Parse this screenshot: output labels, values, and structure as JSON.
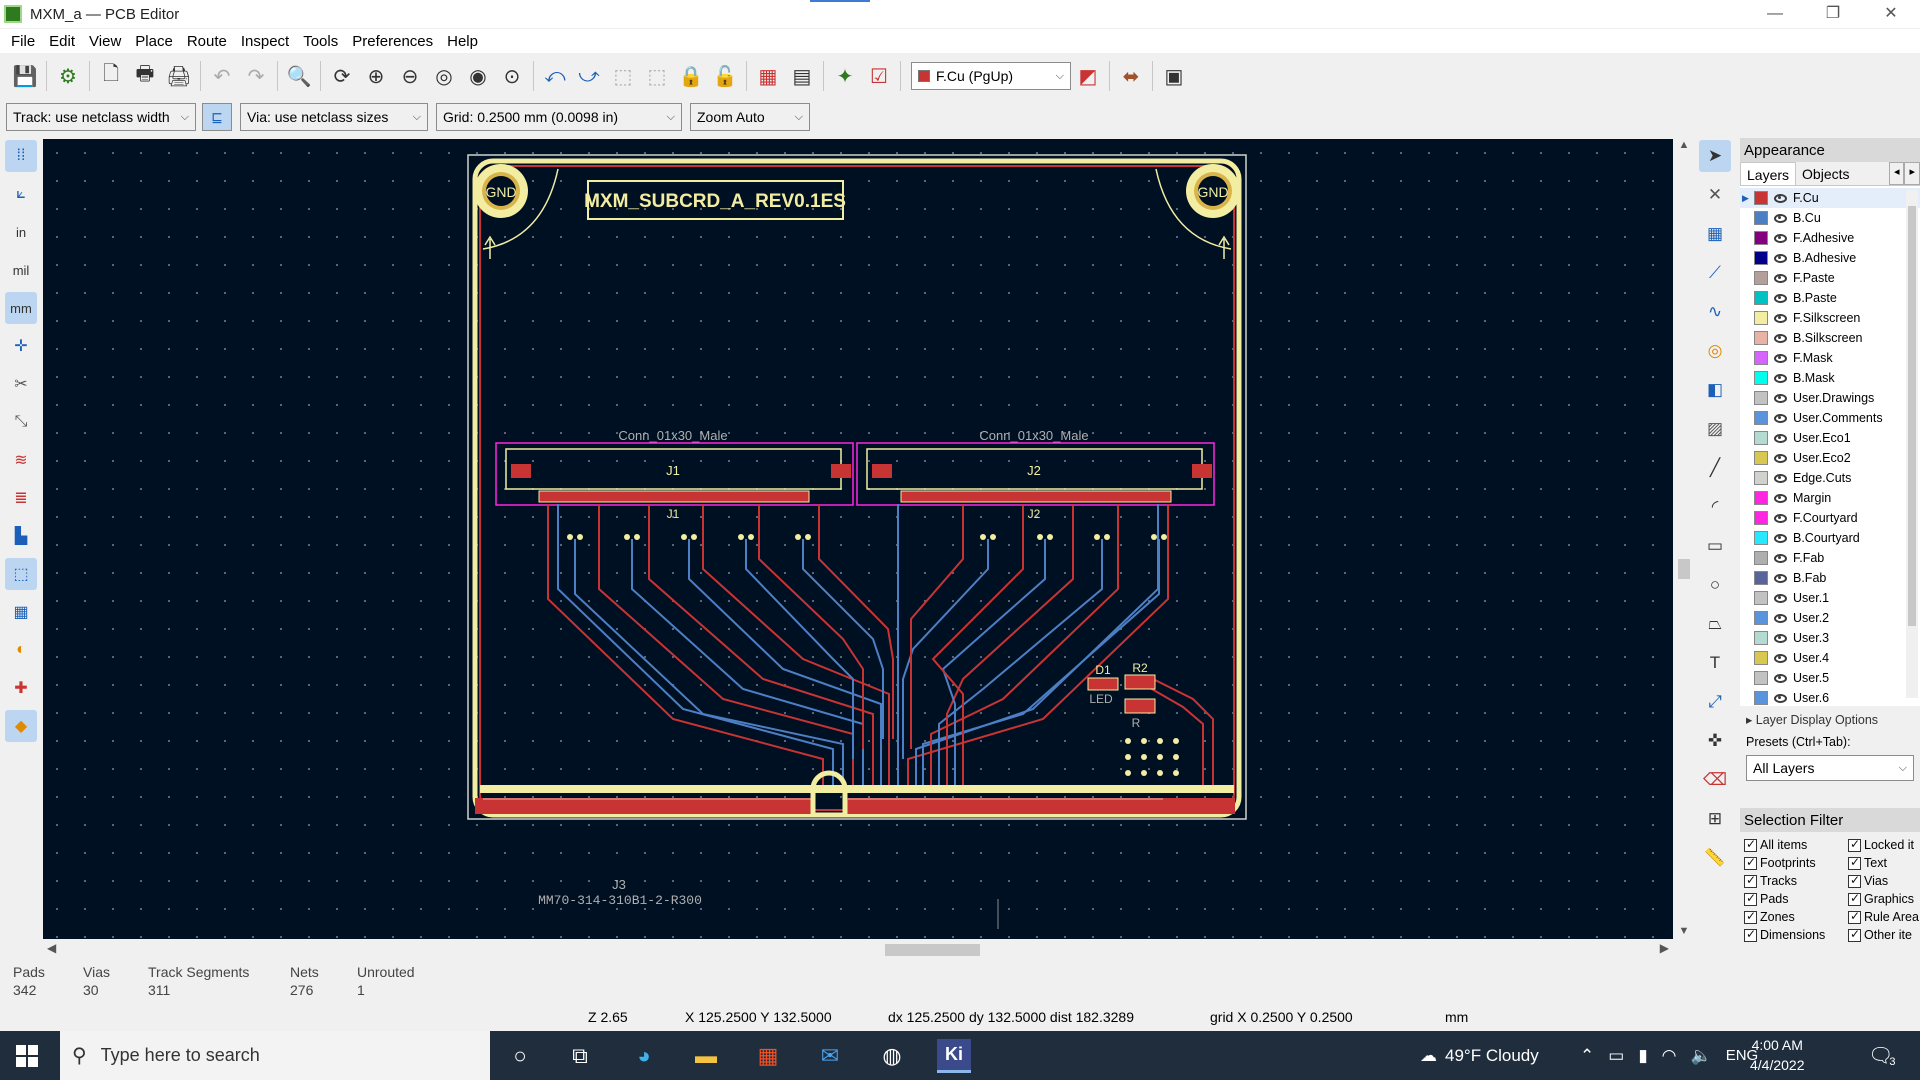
{
  "window": {
    "title": "MXM_a — PCB Editor",
    "controls": [
      "—",
      "❐",
      "✕"
    ]
  },
  "menu": [
    "File",
    "Edit",
    "View",
    "Place",
    "Route",
    "Inspect",
    "Tools",
    "Preferences",
    "Help"
  ],
  "toolbar": {
    "layer_selector": "F.Cu (PgUp)"
  },
  "toolbar2": {
    "track": "Track: use netclass width",
    "via": "Via: use netclass sizes",
    "grid": "Grid: 0.2500 mm (0.0098 in)",
    "zoom": "Zoom Auto"
  },
  "left_toolbar": {
    "in_label": "in",
    "mil_label": "mil",
    "mm_label": "mm"
  },
  "pcb": {
    "board_title": "MXM_SUBCRD_A_REV0.1ES",
    "gnd_label": "GND",
    "connectors": [
      {
        "value": "Conn_01x30_Male",
        "ref": "J1"
      },
      {
        "value": "Conn_01x30_Male",
        "ref": "J2"
      }
    ],
    "edge_connector": {
      "ref": "J3",
      "value": "MM70-314-310B1-2-R300"
    },
    "d1_ref": "D1",
    "d1_value": "LED",
    "r2_ref": "R2",
    "r_value": "R"
  },
  "appearance": {
    "title": "Appearance",
    "tabs": [
      "Layers",
      "Objects"
    ],
    "layers": [
      {
        "name": "F.Cu",
        "color": "#c83434"
      },
      {
        "name": "B.Cu",
        "color": "#4d7fc4"
      },
      {
        "name": "F.Adhesive",
        "color": "#84007f"
      },
      {
        "name": "B.Adhesive",
        "color": "#00008a"
      },
      {
        "name": "F.Paste",
        "color": "#b4a09a"
      },
      {
        "name": "B.Paste",
        "color": "#00c2c2"
      },
      {
        "name": "F.Silkscreen",
        "color": "#f2eda1"
      },
      {
        "name": "B.Silkscreen",
        "color": "#e8b2a7"
      },
      {
        "name": "F.Mask",
        "color": "#d864ff"
      },
      {
        "name": "B.Mask",
        "color": "#02ffee"
      },
      {
        "name": "User.Drawings",
        "color": "#c2c2c2"
      },
      {
        "name": "User.Comments",
        "color": "#5994dc"
      },
      {
        "name": "User.Eco1",
        "color": "#b4dbd2"
      },
      {
        "name": "User.Eco2",
        "color": "#d8c852"
      },
      {
        "name": "Edge.Cuts",
        "color": "#d0d2cd"
      },
      {
        "name": "Margin",
        "color": "#ff26e2"
      },
      {
        "name": "F.Courtyard",
        "color": "#ff26e2"
      },
      {
        "name": "B.Courtyard",
        "color": "#26e9ff"
      },
      {
        "name": "F.Fab",
        "color": "#afafaf"
      },
      {
        "name": "B.Fab",
        "color": "#58659b"
      },
      {
        "name": "User.1",
        "color": "#c2c2c2"
      },
      {
        "name": "User.2",
        "color": "#5994dc"
      },
      {
        "name": "User.3",
        "color": "#b4dbd2"
      },
      {
        "name": "User.4",
        "color": "#d8c852"
      },
      {
        "name": "User.5",
        "color": "#c2c2c2"
      },
      {
        "name": "User.6",
        "color": "#5994dc"
      }
    ],
    "layer_display_options": "Layer Display Options",
    "presets_label": "Presets (Ctrl+Tab):",
    "presets_value": "All Layers"
  },
  "selection_filter": {
    "title": "Selection Filter",
    "items": [
      "All items",
      "Locked it",
      "Footprints",
      "Text",
      "Tracks",
      "Vias",
      "Pads",
      "Graphics",
      "Zones",
      "Rule Area",
      "Dimensions",
      "Other ite"
    ]
  },
  "board_info": {
    "pads_label": "Pads",
    "pads": "342",
    "vias_label": "Vias",
    "vias": "30",
    "tracks_label": "Track Segments",
    "tracks": "311",
    "nets_label": "Nets",
    "nets": "276",
    "unrouted_label": "Unrouted",
    "unrouted": "1"
  },
  "status": {
    "zoom": "Z 2.65",
    "xy": "X 125.2500  Y 132.5000",
    "delta": "dx 125.2500  dy 132.5000  dist 182.3289",
    "grid": "grid X 0.2500  Y 0.2500",
    "units": "mm"
  },
  "taskbar": {
    "search_placeholder": "Type here to search",
    "weather": "49°F  Cloudy",
    "lang": "ENG",
    "time": "4:00 AM",
    "date": "4/4/2022",
    "notifications": "3"
  }
}
